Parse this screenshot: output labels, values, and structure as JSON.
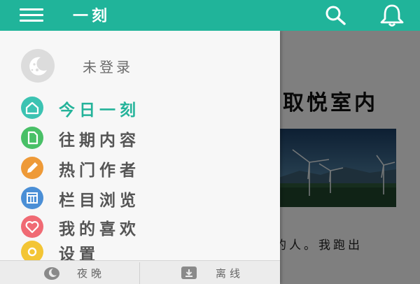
{
  "app_bar": {
    "title": "一刻",
    "bg_color": "#20b49a",
    "menu_icon": "hamburger-menu-icon",
    "search_icon": "search-icon",
    "notification_icon": "bell-icon"
  },
  "background_article": {
    "title_fragment": "取悦室内",
    "snippet_fragment": "的人。我跑出"
  },
  "drawer": {
    "login_text": "未登录",
    "avatar_icon": "moon-avatar-icon",
    "items": [
      {
        "label": "今日一刻",
        "icon": "home-icon",
        "color": "#3cc3b2",
        "active": true
      },
      {
        "label": "往期内容",
        "icon": "document-icon",
        "color": "#49c067",
        "active": false
      },
      {
        "label": "热门作者",
        "icon": "pencil-icon",
        "color": "#ee9a38",
        "active": false
      },
      {
        "label": "栏目浏览",
        "icon": "columns-icon",
        "color": "#4b8fd6",
        "active": false
      },
      {
        "label": "我的喜欢",
        "icon": "heart-icon",
        "color": "#f06a74",
        "active": false
      },
      {
        "label": "设置",
        "icon": "gear-icon",
        "color": "#f3c535",
        "active": false
      }
    ],
    "bottom": {
      "night_label": "夜晚",
      "night_icon": "moon-icon",
      "offline_label": "离线",
      "offline_icon": "download-icon"
    }
  },
  "colors": {
    "accent": "#20b49a",
    "active_text": "#24b39a"
  }
}
